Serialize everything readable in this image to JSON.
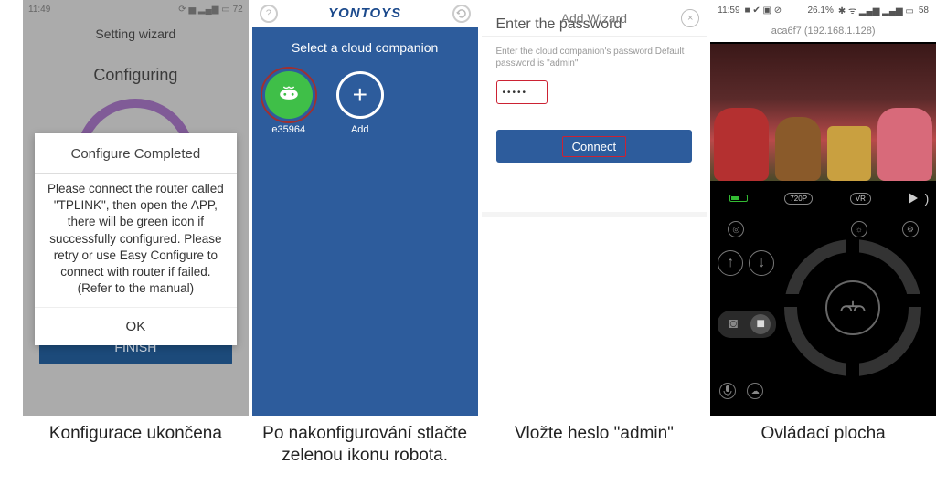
{
  "panel1": {
    "status_time": "11:49",
    "status_right": "72",
    "header": "Setting wizard",
    "configuring": "Configuring",
    "dialog_title": "Configure Completed",
    "dialog_body": "Please connect the router called \"TPLINK\", then open the APP, there will be green icon if successfully configured. Please retry or use Easy Configure to connect with router if failed.(Refer to the manual)",
    "ok": "OK",
    "finish": "FINISH"
  },
  "panel2": {
    "brand": "YONTOYS",
    "subtitle": "Select a cloud companion",
    "robot_id": "e35964",
    "add_label": "Add",
    "help": "?",
    "plus": "+"
  },
  "panel3": {
    "title": "Add Wizard",
    "close": "×",
    "heading": "Enter the password",
    "hint": "Enter the cloud companion's password.Default password is \"admin\"",
    "password_mask": "•••••",
    "connect": "Connect"
  },
  "panel4": {
    "status_time": "11:59",
    "status_pct": "26.1%",
    "status_batt": "58",
    "device_line": "aca6f7 (192.168.1.128)",
    "badge_720p": "720P",
    "badge_vr": "VR"
  },
  "captions": {
    "c1": "Konfigurace ukončena",
    "c2": "Po nakonfigurování stlačte zelenou ikonu robota.",
    "c3": "Vložte heslo \"admin\"",
    "c4": "Ovládací plocha"
  }
}
